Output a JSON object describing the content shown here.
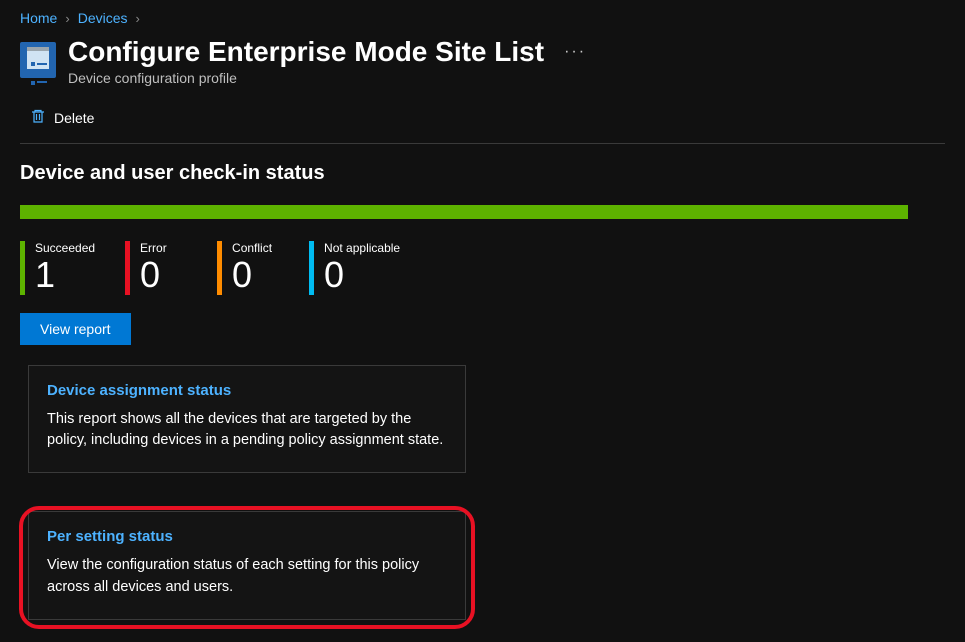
{
  "breadcrumb": {
    "home": "Home",
    "devices": "Devices"
  },
  "header": {
    "title": "Configure Enterprise Mode Site List",
    "subtitle": "Device configuration profile"
  },
  "toolbar": {
    "delete_label": "Delete"
  },
  "status": {
    "section_title": "Device and user check-in status",
    "metrics": {
      "succeeded_label": "Succeeded",
      "succeeded_value": "1",
      "error_label": "Error",
      "error_value": "0",
      "conflict_label": "Conflict",
      "conflict_value": "0",
      "na_label": "Not applicable",
      "na_value": "0"
    },
    "view_report_label": "View report"
  },
  "cards": {
    "device_assignment": {
      "title": "Device assignment status",
      "desc": "This report shows all the devices that are targeted by the policy, including devices in a pending policy assignment state."
    },
    "per_setting": {
      "title": "Per setting status",
      "desc": "View the configuration status of each setting for this policy across all devices and users."
    }
  }
}
